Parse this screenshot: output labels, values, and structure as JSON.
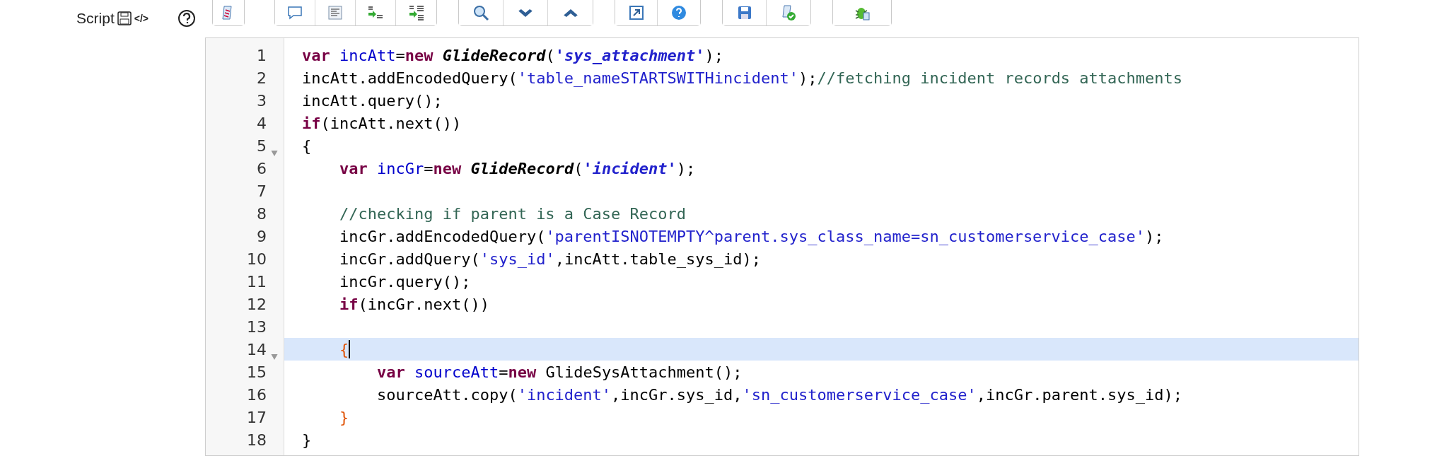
{
  "field": {
    "label": "Script",
    "code_tag": "</>"
  },
  "toolbar": [
    {
      "buttons": [
        {
          "kind": "script"
        }
      ]
    },
    {
      "buttons": [
        {
          "kind": "comment"
        },
        {
          "kind": "format"
        },
        {
          "kind": "replace"
        },
        {
          "kind": "replace_all"
        }
      ]
    },
    {
      "buttons": [
        {
          "kind": "search"
        },
        {
          "kind": "next"
        },
        {
          "kind": "previous"
        }
      ]
    },
    {
      "buttons": [
        {
          "kind": "fullscreen"
        },
        {
          "kind": "help"
        }
      ]
    },
    {
      "buttons": [
        {
          "kind": "save"
        },
        {
          "kind": "check"
        }
      ]
    },
    {
      "buttons": [
        {
          "kind": "debug"
        }
      ]
    }
  ],
  "lines": [
    {
      "number": "1",
      "fold": false,
      "active": false,
      "tokens": [
        {
          "kind": "keyword",
          "t": "var "
        },
        {
          "kind": "def",
          "t": "incAtt"
        },
        {
          "kind": "plain",
          "t": "="
        },
        {
          "kind": "keyword",
          "t": "new "
        },
        {
          "kind": "type",
          "t": "GlideRecord"
        },
        {
          "kind": "plain",
          "t": "("
        },
        {
          "kind": "string_em",
          "t": "'sys_attachment'"
        },
        {
          "kind": "plain",
          "t": ");"
        }
      ]
    },
    {
      "number": "2",
      "fold": false,
      "active": false,
      "tokens": [
        {
          "kind": "plain",
          "t": "incAtt.addEncodedQuery("
        },
        {
          "kind": "string",
          "t": "'table_nameSTARTSWITHincident'"
        },
        {
          "kind": "plain",
          "t": ");"
        },
        {
          "kind": "comment",
          "t": "//fetching incident records attachments"
        }
      ]
    },
    {
      "number": "3",
      "fold": false,
      "active": false,
      "tokens": [
        {
          "kind": "plain",
          "t": "incAtt.query();"
        }
      ]
    },
    {
      "number": "4",
      "fold": false,
      "active": false,
      "tokens": [
        {
          "kind": "keyword",
          "t": "if"
        },
        {
          "kind": "plain",
          "t": "(incAtt.next())"
        }
      ]
    },
    {
      "number": "5",
      "fold": true,
      "active": false,
      "tokens": [
        {
          "kind": "plain",
          "t": "{"
        }
      ]
    },
    {
      "number": "6",
      "fold": false,
      "active": false,
      "tokens": [
        {
          "kind": "keyword",
          "t": "    var "
        },
        {
          "kind": "def",
          "t": "incGr"
        },
        {
          "kind": "plain",
          "t": "="
        },
        {
          "kind": "keyword",
          "t": "new "
        },
        {
          "kind": "type",
          "t": "GlideRecord"
        },
        {
          "kind": "plain",
          "t": "("
        },
        {
          "kind": "string_em",
          "t": "'incident'"
        },
        {
          "kind": "plain",
          "t": ");"
        }
      ]
    },
    {
      "number": "7",
      "fold": false,
      "active": false
    },
    {
      "number": "8",
      "fold": false,
      "active": false,
      "tokens": [
        {
          "kind": "comment",
          "t": "    //checking if parent is a Case Record"
        }
      ]
    },
    {
      "number": "9",
      "fold": false,
      "active": false,
      "tokens": [
        {
          "kind": "plain",
          "t": "    incGr.addEncodedQuery("
        },
        {
          "kind": "string",
          "t": "'parentISNOTEMPTY^parent.sys_class_name=sn_customerservice_case'"
        },
        {
          "kind": "plain",
          "t": ");"
        }
      ]
    },
    {
      "number": "10",
      "fold": false,
      "active": false,
      "tokens": [
        {
          "kind": "plain",
          "t": "    incGr.addQuery("
        },
        {
          "kind": "string",
          "t": "'sys_id'"
        },
        {
          "kind": "plain",
          "t": ",incAtt.table_sys_id);"
        }
      ]
    },
    {
      "number": "11",
      "fold": false,
      "active": false,
      "tokens": [
        {
          "kind": "plain",
          "t": "    incGr.query();"
        }
      ]
    },
    {
      "number": "12",
      "fold": false,
      "active": false,
      "tokens": [
        {
          "kind": "keyword",
          "t": "    if"
        },
        {
          "kind": "plain",
          "t": "(incGr.next())"
        }
      ]
    },
    {
      "number": "13",
      "fold": false,
      "active": false
    },
    {
      "number": "14",
      "fold": true,
      "active": true,
      "tokens": [
        {
          "kind": "bracket",
          "t": "    {"
        }
      ]
    },
    {
      "number": "15",
      "fold": false,
      "active": false,
      "tokens": [
        {
          "kind": "keyword",
          "t": "        var "
        },
        {
          "kind": "def",
          "t": "sourceAtt"
        },
        {
          "kind": "plain",
          "t": "="
        },
        {
          "kind": "keyword",
          "t": "new "
        },
        {
          "kind": "plain",
          "t": "GlideSysAttachment();"
        }
      ]
    },
    {
      "number": "16",
      "fold": false,
      "active": false,
      "tokens": [
        {
          "kind": "plain",
          "t": "        sourceAtt.copy("
        },
        {
          "kind": "string",
          "t": "'incident'"
        },
        {
          "kind": "plain",
          "t": ",incGr.sys_id,"
        },
        {
          "kind": "string",
          "t": "'sn_customerservice_case'"
        },
        {
          "kind": "plain",
          "t": ",incGr.parent.sys_id);"
        }
      ]
    },
    {
      "number": "17",
      "fold": false,
      "active": false,
      "tokens": [
        {
          "kind": "bracket",
          "t": "    }"
        }
      ]
    },
    {
      "number": "18",
      "fold": false,
      "active": false,
      "tokens": [
        {
          "kind": "plain",
          "t": "}"
        }
      ]
    }
  ]
}
